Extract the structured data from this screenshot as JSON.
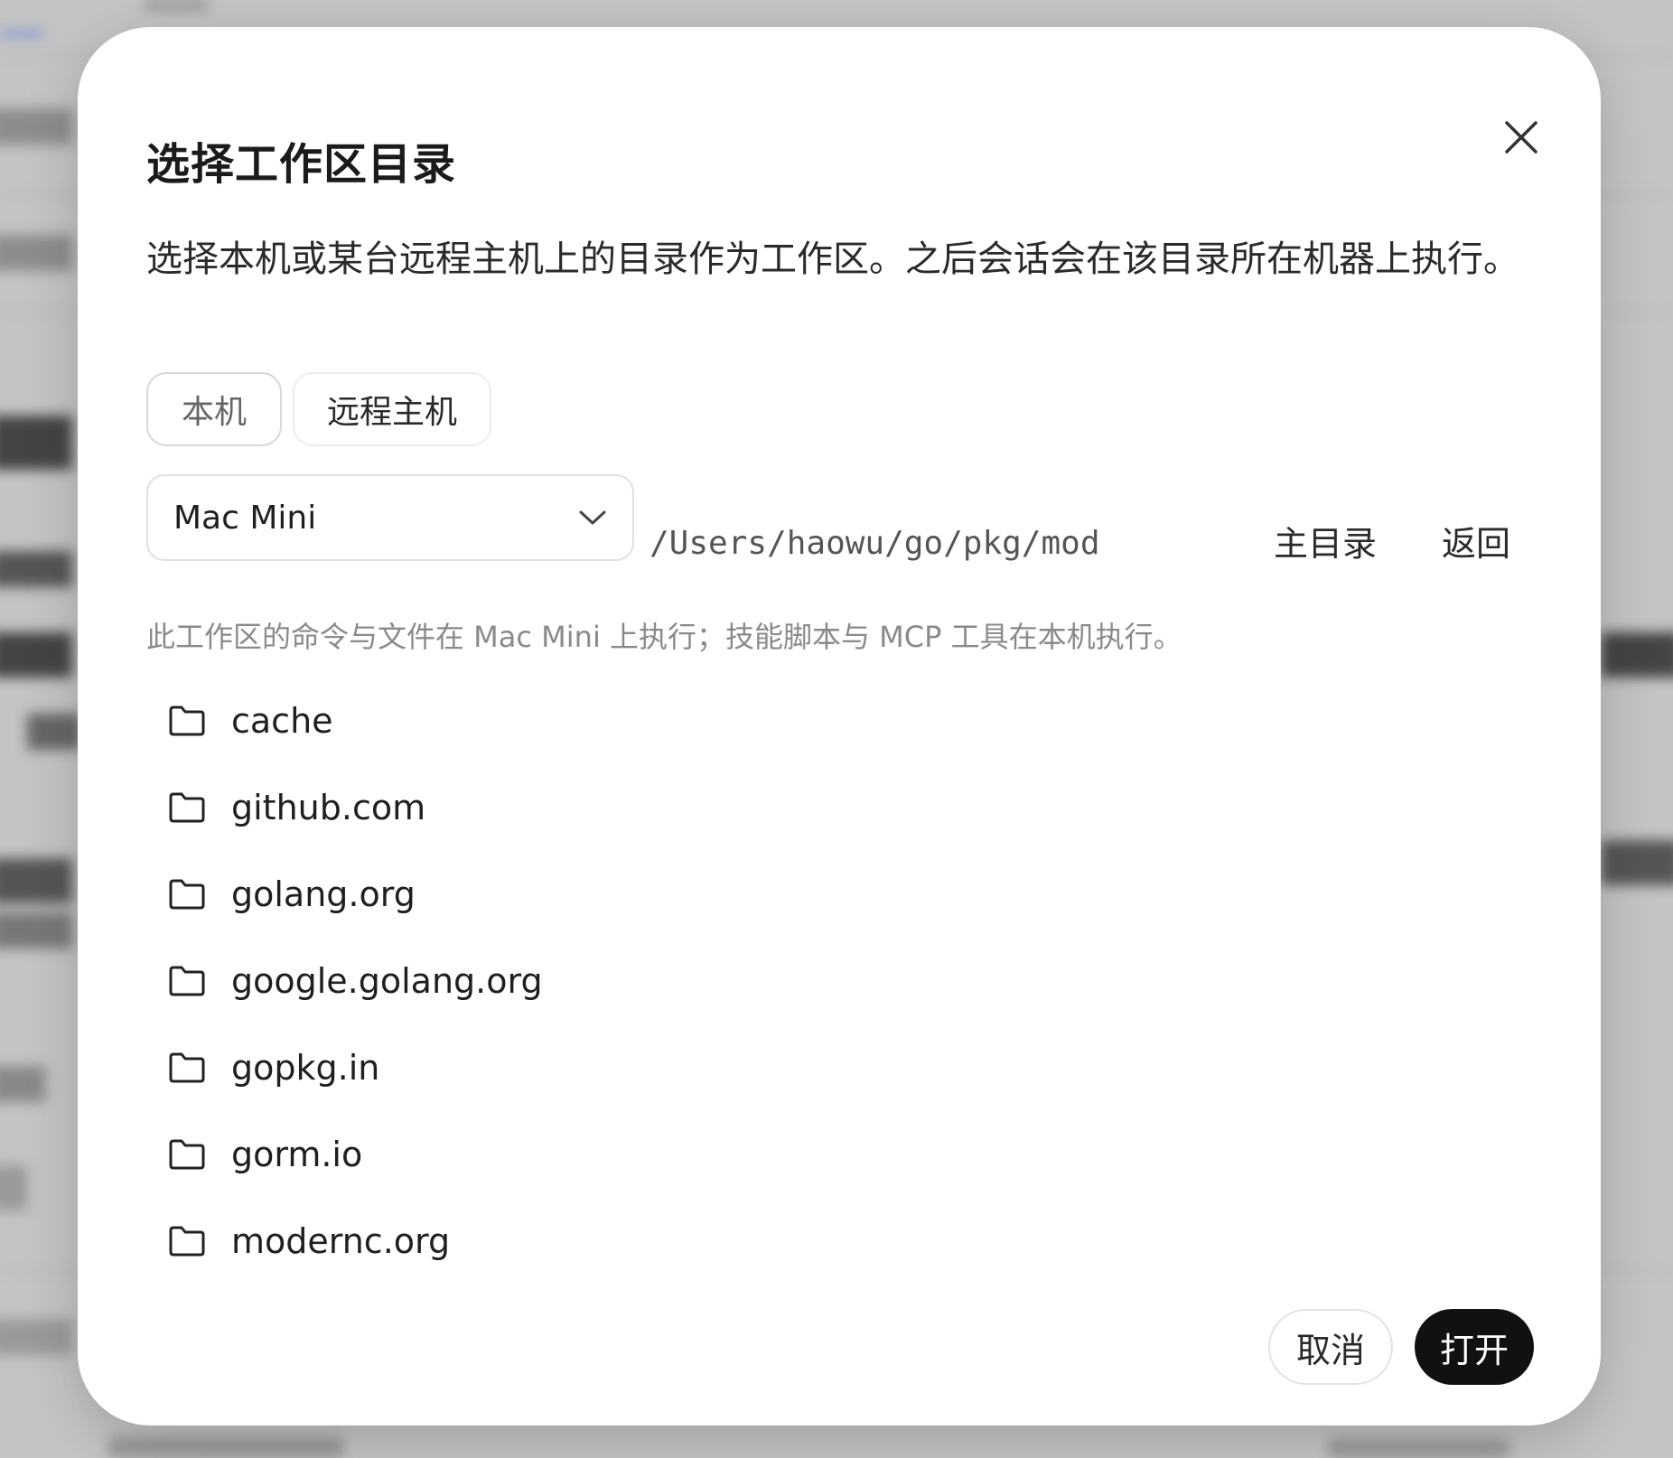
{
  "dialog": {
    "title": "选择工作区目录",
    "description": "选择本机或某台远程主机上的目录作为工作区。之后会话会在该目录所在机器上执行。",
    "tabs": [
      {
        "label": "本机"
      },
      {
        "label": "远程主机"
      }
    ],
    "host_select": {
      "value": "Mac Mini",
      "icon": "chevron-down-icon"
    },
    "path": "/Users/haowu/go/pkg/mod",
    "home_label": "主目录",
    "back_label": "返回",
    "hint": "此工作区的命令与文件在 Mac Mini 上执行；技能脚本与 MCP 工具在本机执行。",
    "directories": [
      {
        "name": "cache"
      },
      {
        "name": "github.com"
      },
      {
        "name": "golang.org"
      },
      {
        "name": "google.golang.org"
      },
      {
        "name": "gopkg.in"
      },
      {
        "name": "gorm.io"
      },
      {
        "name": "modernc.org"
      }
    ],
    "cancel_label": "取消",
    "open_label": "打开"
  },
  "colors": {
    "overlay": "#c4c4c4",
    "dialog_bg": "#ffffff",
    "primary_button": "#111111",
    "hint_text": "#8a8a8a"
  }
}
